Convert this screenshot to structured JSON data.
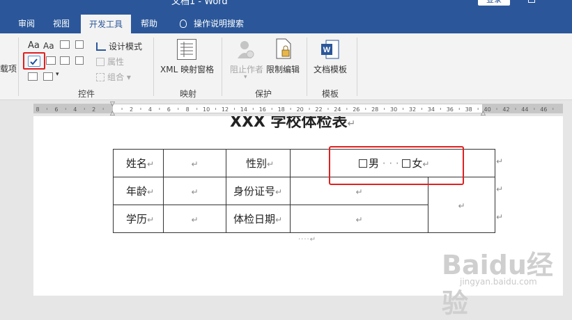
{
  "window": {
    "title": "文档1 - Word",
    "login_label": "登录"
  },
  "tabs": [
    {
      "label": "审阅"
    },
    {
      "label": "视图"
    },
    {
      "label": "开发工具",
      "active": true
    },
    {
      "label": "帮助"
    },
    {
      "label": "操作说明搜索"
    }
  ],
  "ribbon": {
    "left_item": "载项",
    "controls": {
      "design_mode": "设计模式",
      "properties": "属性",
      "group": "组合",
      "label": "控件"
    },
    "mapping": {
      "xml_pane": "XML 映射窗格",
      "label": "映射"
    },
    "protect": {
      "block_authors": "阻止作者",
      "restrict_editing": "限制编辑",
      "label": "保护"
    },
    "templates": {
      "document_template": "文档模板",
      "label": "模板"
    }
  },
  "ruler": {
    "ticks": [
      "8",
      "6",
      "4",
      "2",
      "",
      "2",
      "4",
      "6",
      "8",
      "10",
      "12",
      "14",
      "16",
      "18",
      "20",
      "22",
      "24",
      "26",
      "28",
      "30",
      "32",
      "34",
      "36",
      "38",
      "40",
      "42",
      "44",
      "46"
    ]
  },
  "document": {
    "title": "XXX 学校体检表",
    "return_mark": "↵",
    "rows": [
      {
        "c1": "姓名",
        "c3": "性别",
        "checkbox_male": "男",
        "checkbox_female": "女"
      },
      {
        "c1": "年龄",
        "c3": "身份证号"
      },
      {
        "c1": "学历",
        "c3": "体检日期"
      }
    ],
    "trailing_dots": "····↵"
  },
  "watermark": {
    "brand": "Baidu经验",
    "url": "jingyan.baidu.com"
  },
  "colors": {
    "brand": "#2b579a",
    "highlight": "#e02020"
  }
}
